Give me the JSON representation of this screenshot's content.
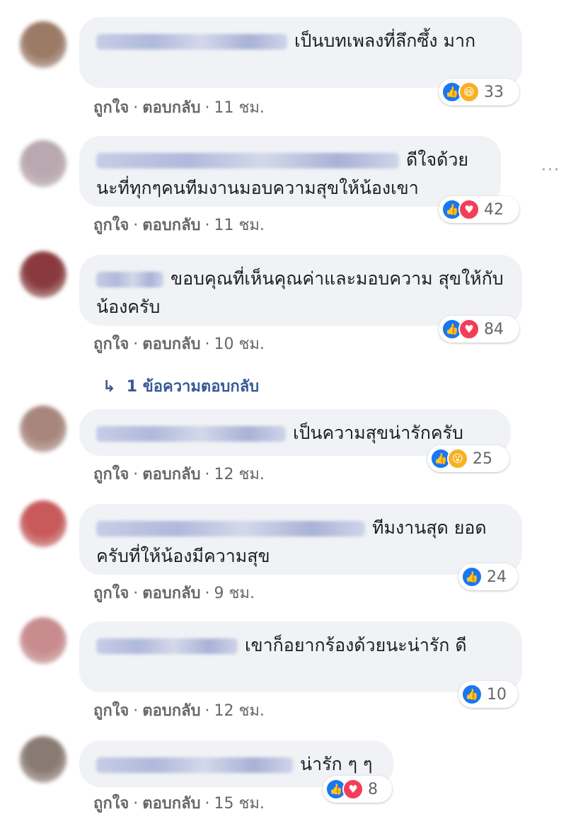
{
  "comments": [
    {
      "text": "เป็นบทเพลงที่ลึกซึ้ง มาก",
      "reactions": [
        "like",
        "haha"
      ],
      "count": "33",
      "like_label": "ถูกใจ",
      "reply_label": "ตอบกลับ",
      "time": "11 ชม.",
      "avatar_color": "#9b7a66"
    },
    {
      "text": "ดีใจด้วย นะที่ทุกๆคนทีมงานมอบความสุขให้น้องเขา",
      "reactions": [
        "like",
        "love"
      ],
      "count": "42",
      "like_label": "ถูกใจ",
      "reply_label": "ตอบกลับ",
      "time": "11 ชม.",
      "avatar_color": "#b9a8b0"
    },
    {
      "text": "ขอบคุณที่เห็นคุณค่าและมอบความ สุขให้กับน้องครับ",
      "reactions": [
        "like",
        "love"
      ],
      "count": "84",
      "like_label": "ถูกใจ",
      "reply_label": "ตอบกลับ",
      "time": "10 ชม.",
      "avatar_color": "#8a3a3e"
    },
    {
      "text": "เป็นความสุขน่ารักครับ",
      "reactions": [
        "like",
        "wow"
      ],
      "count": "25",
      "like_label": "ถูกใจ",
      "reply_label": "ตอบกลับ",
      "time": "12 ชม.",
      "avatar_color": "#a8867e"
    },
    {
      "text": "ทีมงานสุด ยอดครับที่ให้น้องมีความสุข",
      "reactions": [
        "like"
      ],
      "count": "24",
      "like_label": "ถูกใจ",
      "reply_label": "ตอบกลับ",
      "time": "9 ชม.",
      "avatar_color": "#c9595a"
    },
    {
      "text": "เขาก็อยากร้องด้วยนะน่ารัก ดี",
      "reactions": [
        "like"
      ],
      "count": "10",
      "like_label": "ถูกใจ",
      "reply_label": "ตอบกลับ",
      "time": "12 ชม.",
      "avatar_color": "#c98c8e"
    },
    {
      "text": "น่ารัก ๆ ๆ",
      "reactions": [
        "like",
        "love"
      ],
      "count": "8",
      "like_label": "ถูกใจ",
      "reply_label": "ตอบกลับ",
      "time": "15 ชม.",
      "avatar_color": "#8a7a74"
    }
  ],
  "reply_link": {
    "arrow": "↳",
    "label": "1 ข้อความตอบกลับ"
  },
  "more_dots": "···",
  "separator": "·",
  "icons": {
    "like": "like-icon",
    "love": "love-icon",
    "haha": "haha-icon",
    "wow": "wow-icon"
  }
}
